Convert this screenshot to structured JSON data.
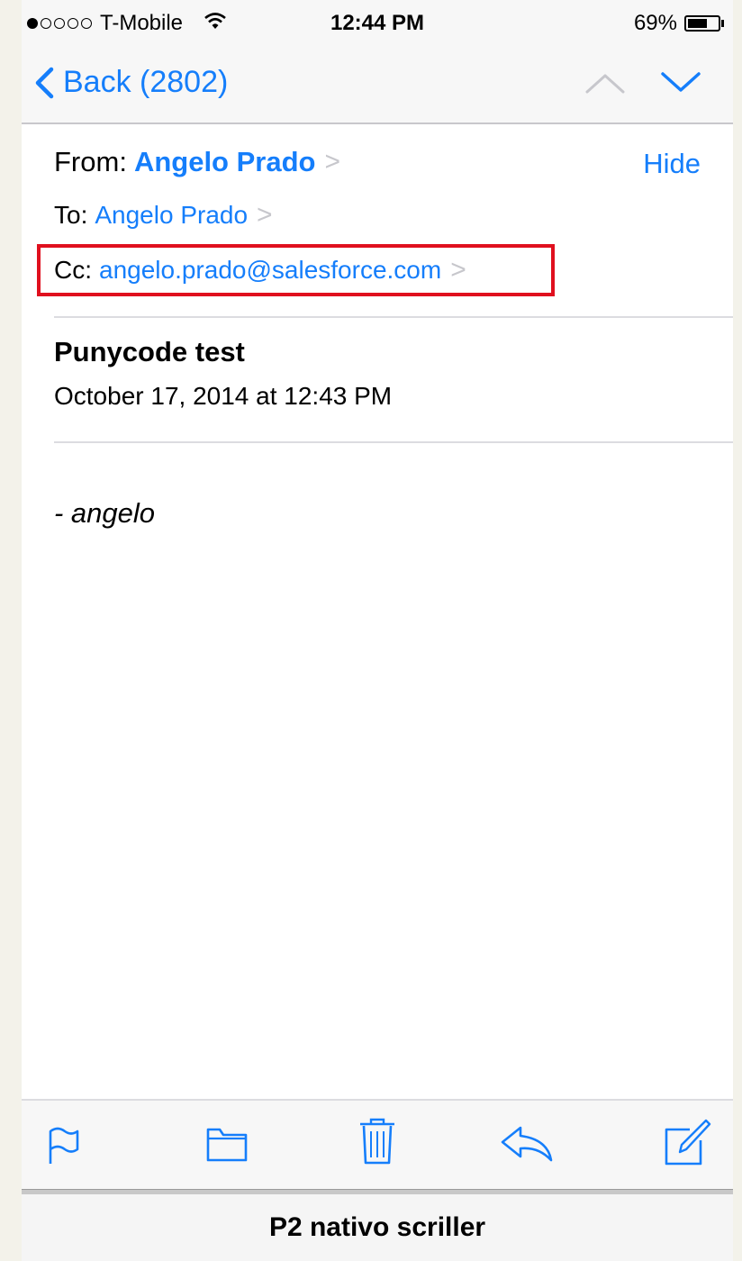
{
  "status_bar": {
    "carrier": "T-Mobile",
    "time": "12:44 PM",
    "battery_percent": "69%",
    "battery_level": 0.69,
    "signal_bars_filled": 1,
    "signal_bars_total": 5
  },
  "nav": {
    "back_label": "Back (2802)",
    "accent_color": "#157efb"
  },
  "header": {
    "from_label": "From:",
    "from_name": "Angelo Prado",
    "hide_label": "Hide",
    "to_label": "To:",
    "to_name": "Angelo Prado",
    "cc_label": "Cc:",
    "cc_address": "angelo.prado@salesforce.com",
    "highlight_color": "#e0101e"
  },
  "message": {
    "subject": "Punycode test",
    "date": "October 17, 2014 at 12:43 PM",
    "body": "- angelo"
  },
  "toolbar": {
    "icons": [
      "flag-icon",
      "folder-icon",
      "trash-icon",
      "reply-icon",
      "compose-icon"
    ]
  },
  "caption": "P2 nativo scriller"
}
